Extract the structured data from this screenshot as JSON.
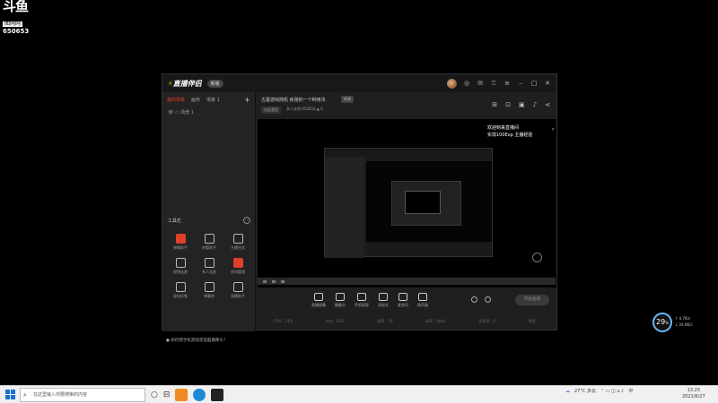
{
  "watermark": {
    "logo": "斗鱼",
    "tag": "图网网",
    "room_id": "650653"
  },
  "app": {
    "name": "直播伴侣",
    "version_badge": "新版",
    "tabs": [
      "我的场景",
      "画布",
      "场景 1"
    ],
    "scene_label": "场景  1",
    "tools_title": "工具栏",
    "tools": [
      {
        "label": "弹幕助手",
        "hot": true
      },
      {
        "label": "房管助手",
        "hot": false
      },
      {
        "label": "主播任务",
        "hot": false
      },
      {
        "label": "视频连麦",
        "hot": false
      },
      {
        "label": "多人连麦",
        "hot": false
      },
      {
        "label": "房间管理",
        "hot": true
      },
      {
        "label": "虚拟形象",
        "hot": false
      },
      {
        "label": "弹幕库",
        "hot": false
      },
      {
        "label": "直播助手",
        "hot": false
      }
    ],
    "notice": "如何把手机游戏或电脑摄像头？",
    "room_title": "古墓游戏随机 疾驰的一个种用法",
    "edit_label": "修改",
    "category": "分区类型",
    "meta": "多人在线  650653  ▲ 0",
    "overlay_line1": "欢迎到来直播间",
    "overlay_line2": "实现100Exp 主播经验",
    "bottom_tools": [
      "直播屏幕",
      "摄像头",
      "手机投屏",
      "添加文",
      "麦克风",
      "扬声器"
    ],
    "live_button": "开始直播",
    "status": [
      "CPU：24%",
      "内存：62%",
      "帧率：30",
      "码率：0kb/s",
      "丢帧率：0",
      "带宽："
    ]
  },
  "widget": {
    "value": "29",
    "unit": "%",
    "up": "4.7K/s",
    "down": "24.6K/s"
  },
  "taskbar": {
    "search_placeholder": "在这里输入你要搜索的内容",
    "weather": "27°C 多云",
    "lang": "中",
    "time": "13:25",
    "date": "2021/6/27"
  }
}
